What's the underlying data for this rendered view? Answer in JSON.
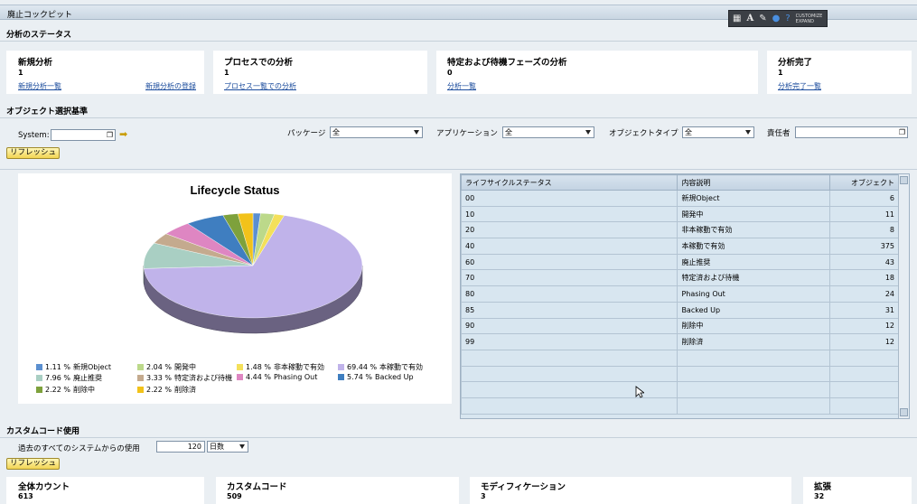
{
  "window": {
    "title": "廃止コックピット"
  },
  "toolbar": {
    "label_top": "CUSTOMIZE",
    "label_bottom": "EXPAND"
  },
  "analysis_status": {
    "heading": "分析のステータス",
    "panels": [
      {
        "title": "新規分析",
        "value": "1",
        "links": [
          "新規分析一覧",
          "新規分析の登録"
        ]
      },
      {
        "title": "プロセスでの分析",
        "value": "1",
        "links": [
          "プロセス一覧での分析"
        ]
      },
      {
        "title": "特定および待機フェーズの分析",
        "value": "0",
        "links": [
          "分析一覧"
        ]
      },
      {
        "title": "分析完了",
        "value": "1",
        "links": [
          "分析完了一覧"
        ]
      }
    ]
  },
  "selection": {
    "heading": "オブジェクト選択基準",
    "system_label": "System:",
    "system_value": "",
    "package_label": "パッケージ",
    "package_value": "全",
    "application_label": "アプリケーション",
    "application_value": "全",
    "objtype_label": "オブジェクトタイプ",
    "objtype_value": "全",
    "owner_label": "責任者",
    "owner_value": "",
    "refresh_label": "リフレッシュ"
  },
  "chart_data": {
    "type": "pie",
    "title": "Lifecycle Status",
    "slices": [
      {
        "label": "新規Object",
        "percent": 1.11,
        "color": "#5b8fd0"
      },
      {
        "label": "開発中",
        "percent": 2.04,
        "color": "#bcd98a"
      },
      {
        "label": "非本稼動で有効",
        "percent": 1.48,
        "color": "#f4e05a"
      },
      {
        "label": "本稼動で有効",
        "percent": 69.44,
        "color": "#c0b3ea"
      },
      {
        "label": "廃止推奨",
        "percent": 7.96,
        "color": "#a9cfc3"
      },
      {
        "label": "特定済および待機",
        "percent": 3.33,
        "color": "#c4aa8e"
      },
      {
        "label": "Phasing Out",
        "percent": 4.44,
        "color": "#de86c2"
      },
      {
        "label": "Backed Up",
        "percent": 5.74,
        "color": "#3f7ec0"
      },
      {
        "label": "削除中",
        "percent": 2.22,
        "color": "#7ea13c"
      },
      {
        "label": "削除済",
        "percent": 2.22,
        "color": "#f2c21a"
      }
    ],
    "legend_placement": "bottom"
  },
  "status_table": {
    "columns": [
      "ライフサイクルステータス",
      "内容説明",
      "オブジェクト"
    ],
    "rows": [
      [
        "00",
        "新規Object",
        "6"
      ],
      [
        "10",
        "開発中",
        "11"
      ],
      [
        "20",
        "非本稼動で有効",
        "8"
      ],
      [
        "40",
        "本稼動で有効",
        "375"
      ],
      [
        "60",
        "廃止推奨",
        "43"
      ],
      [
        "70",
        "特定済および待機",
        "18"
      ],
      [
        "80",
        "Phasing Out",
        "24"
      ],
      [
        "85",
        "Backed Up",
        "31"
      ],
      [
        "90",
        "削除中",
        "12"
      ],
      [
        "99",
        "削除済",
        "12"
      ]
    ]
  },
  "custom_code": {
    "heading": "カスタムコード使用",
    "usage_label": "過去のすべてのシステムからの使用",
    "usage_value": "120",
    "unit_value": "日数",
    "refresh_label": "リフレッシュ",
    "panels": [
      {
        "title": "全体カウント",
        "value": "613"
      },
      {
        "title": "カスタムコード",
        "value": "509"
      },
      {
        "title": "モディフィケーション",
        "value": "3"
      },
      {
        "title": "拡張",
        "value": "32"
      }
    ]
  }
}
